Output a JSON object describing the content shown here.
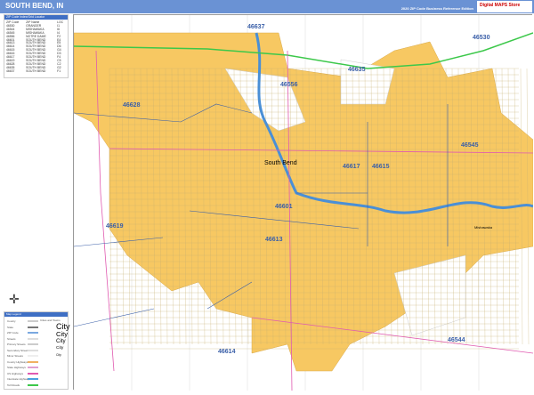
{
  "header": {
    "title": "SOUTH BEND, IN",
    "edition": "2020 ZIP Code Business Reference Edition",
    "logo": "Digital MAPS Store"
  },
  "index": {
    "title": "ZIP Code Index/Grid Locator",
    "columns": [
      "ZIP Code",
      "ZIP Name",
      "LOC"
    ],
    "rows": [
      [
        "46530",
        "GRANGER",
        "I1"
      ],
      [
        "46544",
        "MISHAWAKA",
        "I6"
      ],
      [
        "46545",
        "MISHAWAKA",
        "I4"
      ],
      [
        "46556",
        "NOTRE DAME",
        "F2"
      ],
      [
        "46601",
        "SOUTH BEND",
        "E4"
      ],
      [
        "46613",
        "SOUTH BEND",
        "E5"
      ],
      [
        "46614",
        "SOUTH BEND",
        "D6"
      ],
      [
        "46615",
        "SOUTH BEND",
        "G4"
      ],
      [
        "46616",
        "SOUTH BEND",
        "D3"
      ],
      [
        "46617",
        "SOUTH BEND",
        "F4"
      ],
      [
        "46619",
        "SOUTH BEND",
        "C5"
      ],
      [
        "46628",
        "SOUTH BEND",
        "C2"
      ],
      [
        "46635",
        "SOUTH BEND",
        "G2"
      ],
      [
        "46637",
        "SOUTH BEND",
        "F1"
      ]
    ]
  },
  "legend": {
    "title": "Map Legend",
    "items": [
      "County",
      "State",
      "ZIP Code",
      "Streets",
      "Primary Streets",
      "Secondary Streets",
      "Minor Streets",
      "County Highways",
      "State Highways",
      "US Highways",
      "Interstate Highways",
      "Toll Roads"
    ],
    "cities_title": "Cities and Towns",
    "cities": [
      "City",
      "City",
      "City",
      "City",
      "City"
    ]
  },
  "map": {
    "zips": [
      "46637",
      "46530",
      "46556",
      "46635",
      "46628",
      "46545",
      "46617",
      "46615",
      "46601",
      "46619",
      "46613",
      "46614",
      "46544"
    ],
    "cities": [
      "South Bend",
      "Mishawaka"
    ]
  },
  "colors": {
    "header": "#6a92d4",
    "city": "#f7c862",
    "river": "#4a8fd6",
    "interstate": "#3cc84a",
    "us_highway": "#e05ab0",
    "zip_line": "#3a5fa8"
  }
}
